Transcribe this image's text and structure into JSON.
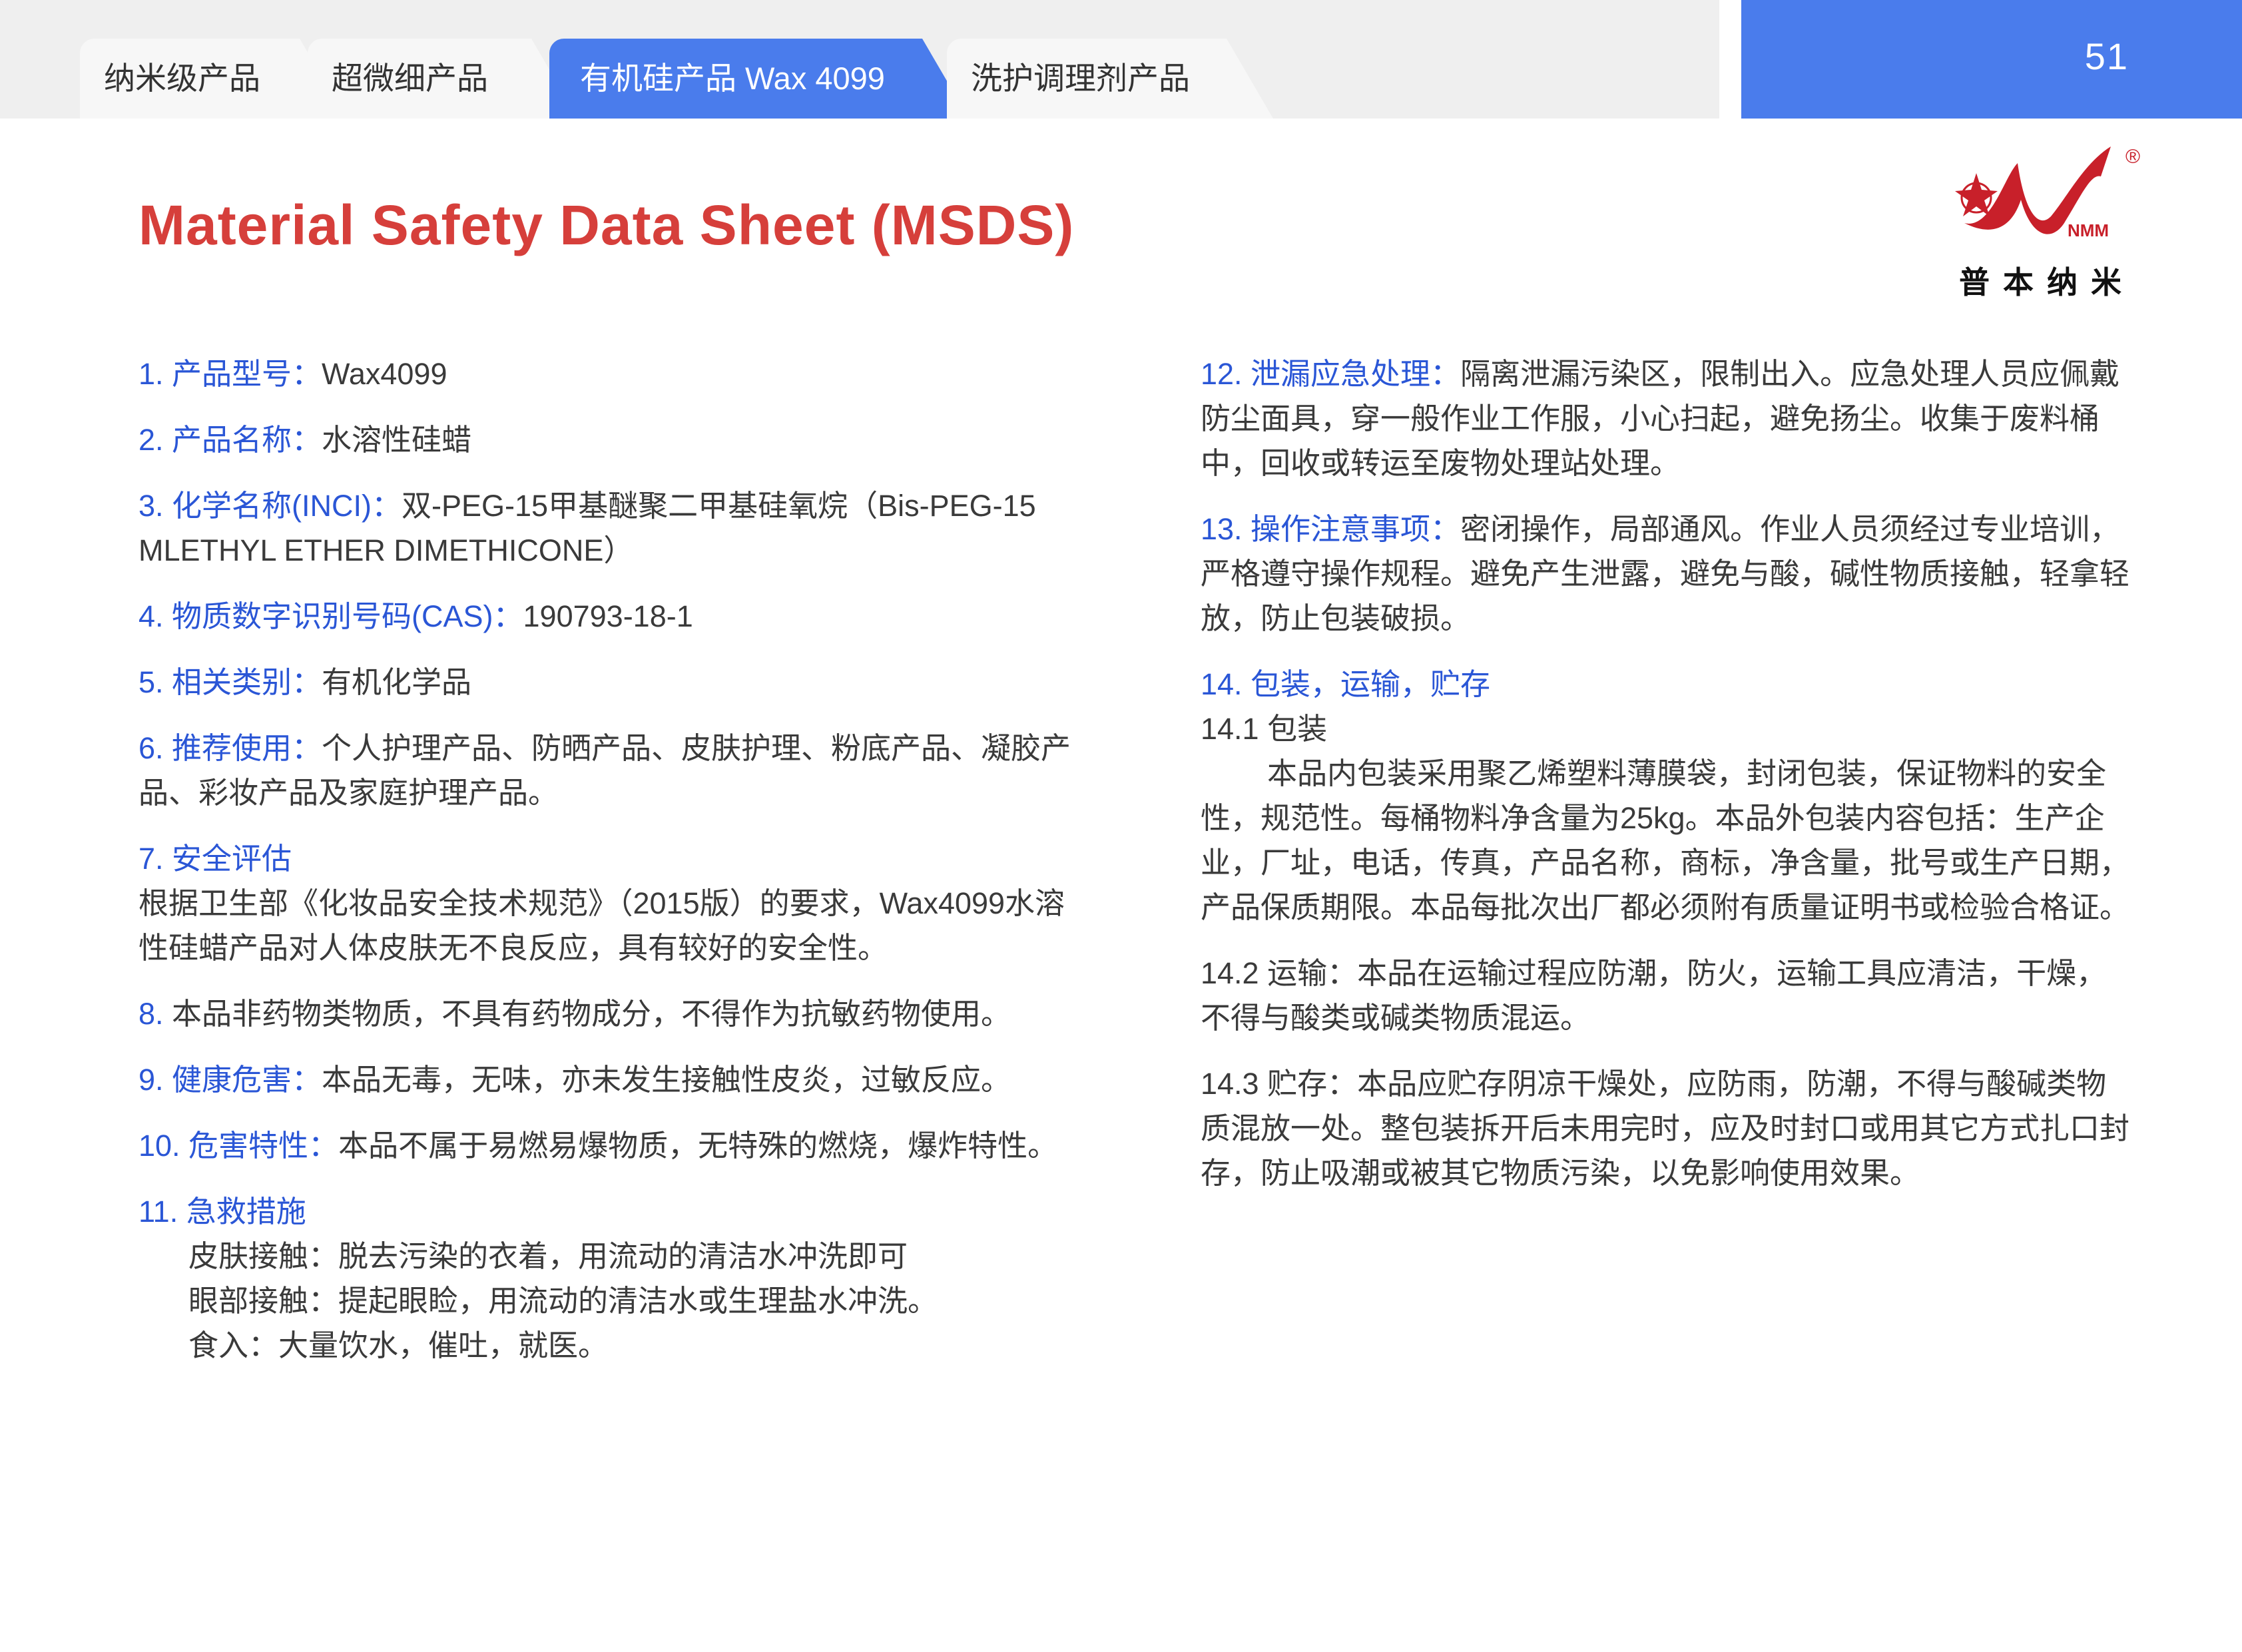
{
  "tabs": [
    {
      "label": "纳米级产品"
    },
    {
      "label": "超微细产品"
    },
    {
      "label": "有机硅产品 Wax 4099"
    },
    {
      "label": "洗护调理剂产品"
    }
  ],
  "page_number": "51",
  "title": "Material Safety Data Sheet (MSDS)",
  "logo": {
    "mark_text": "NMM",
    "registered": "®",
    "name": "普本纳米"
  },
  "left": {
    "i1": {
      "h": "1. 产品型号：",
      "t": "Wax4099"
    },
    "i2": {
      "h": "2. 产品名称：",
      "t": "水溶性硅蜡"
    },
    "i3": {
      "h": "3. 化学名称(INCI)：",
      "t": "双-PEG-15甲基醚聚二甲基硅氧烷（Bis-PEG-15 MLETHYL ETHER DIMETHICONE）"
    },
    "i4": {
      "h": "4. 物质数字识别号码(CAS)：",
      "t": "190793-18-1"
    },
    "i5": {
      "h": "5. 相关类别：",
      "t": "有机化学品"
    },
    "i6": {
      "h": "6. 推荐使用：",
      "t": "个人护理产品、防晒产品、皮肤护理、粉底产品、凝胶产品、彩妆产品及家庭护理产品。"
    },
    "i7": {
      "h": "7. 安全评估",
      "t": "根据卫生部《化妆品安全技术规范》（2015版）的要求，Wax4099水溶性硅蜡产品对人体皮肤无不良反应，具有较好的安全性。"
    },
    "i8": {
      "h": "8.",
      "t": " 本品非药物类物质，不具有药物成分，不得作为抗敏药物使用。"
    },
    "i9": {
      "h": "9. 健康危害：",
      "t": "本品无毒，无味，亦未发生接触性皮炎，过敏反应。"
    },
    "i10": {
      "h": "10. 危害特性：",
      "t": "本品不属于易燃易爆物质，无特殊的燃烧，爆炸特性。"
    },
    "i11": {
      "h": "11. 急救措施",
      "lines": [
        "皮肤接触：脱去污染的衣着，用流动的清洁水冲洗即可",
        "眼部接触：提起眼睑，用流动的清洁水或生理盐水冲洗。",
        "食入：大量饮水，催吐，就医。"
      ]
    }
  },
  "right": {
    "i12": {
      "h": "12. 泄漏应急处理：",
      "t": "隔离泄漏污染区，限制出入。应急处理人员应佩戴防尘面具，穿一般作业工作服，小心扫起，避免扬尘。收集于废料桶中，回收或转运至废物处理站处理。"
    },
    "i13": {
      "h": "13. 操作注意事项：",
      "t": "密闭操作，局部通风。作业人员须经过专业培训，严格遵守操作规程。避免产生泄露，避免与酸，碱性物质接触，轻拿轻放，防止包装破损。"
    },
    "i14": {
      "h": "14. 包装，运输，贮存",
      "s1_title": "14.1 包装",
      "s1_text": "本品内包装采用聚乙烯塑料薄膜袋，封闭包装，保证物料的安全性，规范性。每桶物料净含量为25kg。本品外包装内容包括：生产企业，厂址，电话，传真，产品名称，商标，净含量，批号或生产日期，产品保质期限。本品每批次出厂都必须附有质量证明书或检验合格证。",
      "s2": "14.2 运输：本品在运输过程应防潮，防火，运输工具应清洁，干燥，不得与酸类或碱类物质混运。",
      "s3": "14.3 贮存：本品应贮存阴凉干燥处，应防雨，防潮，不得与酸碱类物质混放一处。整包装拆开后未用完时，应及时封口或用其它方式扎口封存，防止吸潮或被其它物质污染，以免影响使用效果。"
    }
  }
}
